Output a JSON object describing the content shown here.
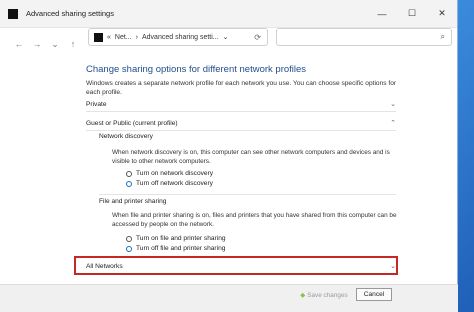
{
  "window": {
    "title": "Advanced sharing settings",
    "controls": {
      "minimize": "—",
      "maximize": "☐",
      "close": "✕"
    }
  },
  "nav": {
    "back": "←",
    "forward": "→",
    "dropdown": "⌄",
    "up": "↑",
    "address_prefix": "«",
    "address_part1": "Net...",
    "address_sep": "›",
    "address_part2": "Advanced sharing setti...",
    "address_dropdown": "⌄",
    "refresh": "⟳",
    "search_icon": "⌕"
  },
  "main": {
    "heading": "Change sharing options for different network profiles",
    "description": "Windows creates a separate network profile for each network you use. You can choose specific options for each profile.",
    "profiles": {
      "private": "Private",
      "guest": "Guest or Public (current profile)",
      "all": "All Networks"
    },
    "network_discovery": {
      "title": "Network discovery",
      "desc": "When network discovery is on, this computer can see other network computers and devices and is visible to other network computers.",
      "on": "Turn on network discovery",
      "off": "Turn off network discovery",
      "selected": "off"
    },
    "file_sharing": {
      "title": "File and printer sharing",
      "desc": "When file and printer sharing is on, files and printers that you have shared from this computer can be accessed by people on the network.",
      "on": "Turn on file and printer sharing",
      "off": "Turn off file and printer sharing",
      "selected": "off"
    }
  },
  "footer": {
    "save": "Save changes",
    "cancel": "Cancel"
  }
}
